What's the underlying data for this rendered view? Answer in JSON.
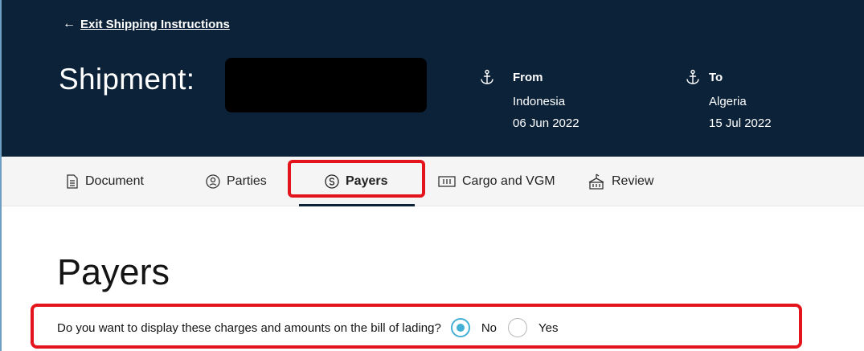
{
  "header": {
    "exit_arrow": "←",
    "exit_link": "Exit Shipping Instructions",
    "shipment_label": "Shipment:",
    "from": {
      "label": "From",
      "place": "Indonesia",
      "date": "06 Jun 2022"
    },
    "to": {
      "label": "To",
      "place": "Algeria",
      "date": "15 Jul 2022"
    }
  },
  "tabs": [
    {
      "label": "Document",
      "icon": "document-icon",
      "active": false
    },
    {
      "label": "Parties",
      "icon": "person-circle-icon",
      "active": false
    },
    {
      "label": "Payers",
      "icon": "dollar-circle-icon",
      "active": true
    },
    {
      "label": "Cargo and VGM",
      "icon": "container-icon",
      "active": false
    },
    {
      "label": "Review",
      "icon": "ship-icon",
      "active": false
    }
  ],
  "page": {
    "title": "Payers",
    "question": "Do you want to display these charges and amounts on the bill of lading?",
    "options": [
      {
        "label": "No",
        "selected": true
      },
      {
        "label": "Yes",
        "selected": false
      }
    ]
  },
  "colors": {
    "header_bg": "#0b2239",
    "tab_bar_bg": "#f5f5f5",
    "highlight": "#e3141b",
    "radio_accent": "#42b0d5"
  }
}
